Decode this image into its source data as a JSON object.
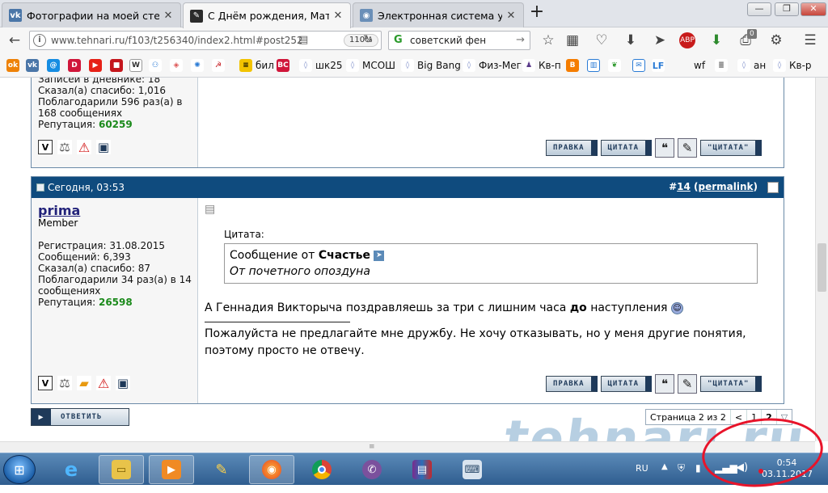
{
  "browser": {
    "tabs": [
      {
        "title": "Фотографии на моей стене",
        "icon": "vk-icon",
        "color": "#4a76a8"
      },
      {
        "title": "С Днём рождения, Матрос",
        "icon": "tehnari-favicon",
        "color": "#2b2b2b"
      },
      {
        "title": "Электронная система учеб",
        "icon": "globe-icon",
        "color": "#6a8fb8"
      }
    ],
    "url": "www.tehnari.ru/f103/t256340/index2.html#post25293",
    "zoom": "110%",
    "search": "советский фен",
    "bookmarks": [
      "бил",
      "шк25",
      "МСОШ",
      "Big Bang",
      "Физ-Мег",
      "Кв-п",
      "wf",
      "ан",
      "Кв-р"
    ],
    "badge_count": "0"
  },
  "post1": {
    "diary": "Записей в дневнике: 18",
    "thanks_said": "Сказал(а) спасибо: 1,016",
    "thanked": "Поблагодарили 596 раз(а) в 168 сообщениях",
    "rep_label": "Репутация:",
    "rep_value": "60259"
  },
  "post2": {
    "time": "Сегодня, 03:53",
    "num_prefix": "#",
    "num": "14",
    "permalink": "permalink",
    "username": "prima",
    "role": "Member",
    "registered": "Регистрация: 31.08.2015",
    "messages": "Сообщений: 6,393",
    "thanks_said": "Сказал(а) спасибо: 87",
    "thanked": "Поблагодарили 34 раз(а) в 14 сообщениях",
    "rep_label": "Репутация:",
    "rep_value": "26598",
    "quote_label": "Цитата:",
    "quote_from_prefix": "Сообщение от",
    "quote_author": "Счастье",
    "quote_text": "От почетного опоздуна",
    "body_before": "А Геннадия Викторыча поздравляешь за три с лишним часа",
    "body_bold": "до",
    "body_after": "наступления",
    "signature": "Пожалуйста не предлагайте мне дружбу. Не хочу отказывать, но у меня другие понятия, поэтому просто не отвечу."
  },
  "buttons": {
    "edit": "ПРАВКА",
    "quote": "ЦИТАТА",
    "quote2": "\"ЦИТАТА\"",
    "reply": "ОТВЕТИТЬ"
  },
  "pager": {
    "label": "Страница 2 из 2",
    "prev": "<",
    "p1": "1",
    "p2": "2"
  },
  "watermark": "tehnari.ru",
  "taskbar": {
    "lang": "RU",
    "time": "0:54",
    "date": "03.11.2017"
  },
  "colors": {
    "header": "#0f4b7e",
    "rep": "#1b8a1b",
    "annotation": "#e8142a"
  }
}
